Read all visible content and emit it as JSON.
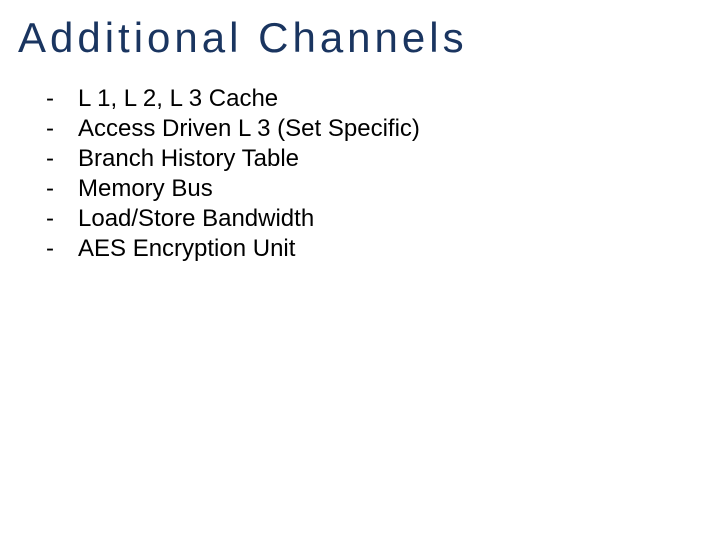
{
  "title": "Additional Channels",
  "bullets": [
    {
      "marker": "-",
      "text": "L 1, L 2, L 3 Cache"
    },
    {
      "marker": "-",
      "text": "Access Driven L 3 (Set Specific)"
    },
    {
      "marker": "-",
      "text": "Branch History Table"
    },
    {
      "marker": "-",
      "text": "Memory Bus"
    },
    {
      "marker": "-",
      "text": "Load/Store Bandwidth"
    },
    {
      "marker": "-",
      "text": "AES Encryption Unit"
    }
  ]
}
